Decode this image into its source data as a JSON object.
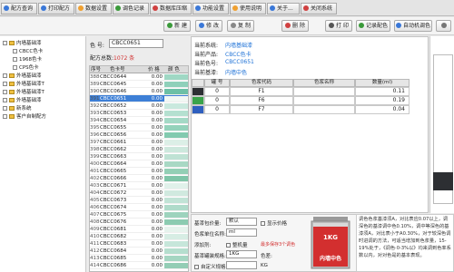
{
  "tabs": [
    {
      "label": "配方查询",
      "color": "#3a78d8"
    },
    {
      "label": "打印配方",
      "color": "#3a78d8"
    },
    {
      "label": "数据设置",
      "color": "#f0a030"
    },
    {
      "label": "调色记录",
      "color": "#3a9a3a"
    },
    {
      "label": "数据库压缩",
      "color": "#d04040"
    },
    {
      "label": "功能设置",
      "color": "#3a78d8"
    },
    {
      "label": "使用说明",
      "color": "#f0a030"
    },
    {
      "label": "关于...",
      "color": "#3a78d8"
    },
    {
      "label": "关闭系统",
      "color": "#d04040"
    }
  ],
  "toolbar": {
    "new": "新 建",
    "edit": "修 改",
    "copy": "复 制",
    "delete": "删 除",
    "print": "打 印",
    "record": "记录配色",
    "auto": "自动机调色"
  },
  "tree": {
    "items": [
      {
        "label": "内墙基础漆",
        "level": 0
      },
      {
        "label": "CBCC色卡",
        "level": 1
      },
      {
        "label": "1968色卡",
        "level": 1
      },
      {
        "label": "CPS色卡",
        "level": 1
      },
      {
        "label": "外墙基础漆",
        "level": 0
      },
      {
        "label": "外墙基础漆T",
        "level": 0
      },
      {
        "label": "外墙基础漆T",
        "level": 0
      },
      {
        "label": "外墙基础漆",
        "level": 0
      },
      {
        "label": "新系统",
        "level": 0
      },
      {
        "label": "客户自制配方",
        "level": 0
      }
    ]
  },
  "list": {
    "color_no_label": "色 号:",
    "color_no_value": "CBCC0651",
    "count_label": "配方总数:",
    "count_value": "1072 条",
    "headers": [
      "序号",
      "色卡号",
      "价 格",
      "颜 色"
    ],
    "rows": [
      {
        "idx": "388",
        "name": "CBCC0644",
        "price": "0.00",
        "color": "#9fd8c4"
      },
      {
        "idx": "389",
        "name": "CBCC0645",
        "price": "0.00",
        "color": "#8fd0ba"
      },
      {
        "idx": "390",
        "name": "CBCC0646",
        "price": "0.00",
        "color": "#6cc0a6"
      },
      {
        "idx": "391",
        "name": "CBCC0651",
        "price": "0.00",
        "color": "#f2f7f4",
        "selected": true
      },
      {
        "idx": "392",
        "name": "CBCC0652",
        "price": "0.00",
        "color": "#c9e9de"
      },
      {
        "idx": "393",
        "name": "CBCC0653",
        "price": "0.00",
        "color": "#b4e0d0"
      },
      {
        "idx": "394",
        "name": "CBCC0654",
        "price": "0.00",
        "color": "#a4d9c6"
      },
      {
        "idx": "395",
        "name": "CBCC0655",
        "price": "0.00",
        "color": "#94d2bb"
      },
      {
        "idx": "396",
        "name": "CBCC0656",
        "price": "0.00",
        "color": "#82caaf"
      },
      {
        "idx": "397",
        "name": "CBCC0661",
        "price": "0.00",
        "color": "#dcefe7"
      },
      {
        "idx": "398",
        "name": "CBCC0662",
        "price": "0.00",
        "color": "#cde8dd"
      },
      {
        "idx": "399",
        "name": "CBCC0663",
        "price": "0.00",
        "color": "#bfe2d4"
      },
      {
        "idx": "400",
        "name": "CBCC0664",
        "price": "0.00",
        "color": "#a8d8c4"
      },
      {
        "idx": "401",
        "name": "CBCC0665",
        "price": "0.00",
        "color": "#93cfb5"
      },
      {
        "idx": "402",
        "name": "CBCC0666",
        "price": "0.00",
        "color": "#7fc5a8"
      },
      {
        "idx": "403",
        "name": "CBCC0671",
        "price": "0.00",
        "color": "#e0f1ea"
      },
      {
        "idx": "404",
        "name": "CBCC0672",
        "price": "0.00",
        "color": "#d0e9df"
      },
      {
        "idx": "405",
        "name": "CBCC0673",
        "price": "0.00",
        "color": "#c1e3d6"
      },
      {
        "idx": "406",
        "name": "CBCC0674",
        "price": "0.00",
        "color": "#afdbca"
      },
      {
        "idx": "407",
        "name": "CBCC0675",
        "price": "0.00",
        "color": "#9dd3bd"
      },
      {
        "idx": "408",
        "name": "CBCC0676",
        "price": "0.00",
        "color": "#8ccbb1"
      },
      {
        "idx": "409",
        "name": "CBCC0681",
        "price": "0.00",
        "color": "#e6f3ed"
      },
      {
        "idx": "410",
        "name": "CBCC0682",
        "price": "0.00",
        "color": "#d7ede4"
      },
      {
        "idx": "411",
        "name": "CBCC0683",
        "price": "0.00",
        "color": "#c6e6da"
      },
      {
        "idx": "412",
        "name": "CBCC0684",
        "price": "0.00",
        "color": "#b5dece"
      },
      {
        "idx": "413",
        "name": "CBCC0685",
        "price": "0.00",
        "color": "#a5d6c2"
      },
      {
        "idx": "414",
        "name": "CBCC0686",
        "price": "0.00",
        "color": "#93cdb5"
      }
    ]
  },
  "formula": {
    "system_label": "当前系统:",
    "system_value": "内墙基础漆",
    "product_label": "当前产品:",
    "product_value": "CBCC色卡",
    "color_label": "当前色号:",
    "color_value": "CBCC0651",
    "base_label": "当前基漆:",
    "base_value": "内墙中色",
    "headers": [
      "罐 号",
      "色浆代码",
      "色浆名称",
      "数量(ml)"
    ],
    "rows": [
      {
        "swatch": "#2d2f33",
        "can": "0",
        "code": "F1",
        "name": "",
        "qty": "0.11"
      },
      {
        "swatch": "#3aa34a",
        "can": "0",
        "code": "F6",
        "name": "",
        "qty": "0.19"
      },
      {
        "swatch": "#2f5fbf",
        "can": "0",
        "code": "F7",
        "name": "",
        "qty": "0.04"
      }
    ]
  },
  "bottom": {
    "currency_label": "基漆包价量:",
    "currency_value": "默认",
    "show_price": "显示价格",
    "unit_label": "色浆单位名称:",
    "unit_value": "ml",
    "sum_label": "添加剂:",
    "sum_check": "整机量",
    "note": "最多保存3个调色",
    "size_label": "基漆罐装规格:",
    "size_value": "1KG",
    "custom_label": "自定义规格:",
    "custom_unit": "KG",
    "diff_label": "色差:",
    "can_size": "1KG",
    "can_name": "内墙中色"
  },
  "description": "调色色浆基漆须A，对比表应0.07以上，调深色的基漆调中色0.10%，调中等深色的基漆须A，对比表小于A0.30%，对于较深色调时进调的方法，可适当增加到色浆量，15-19%处于，《调色·0-3%以》均来调到色率系数以内，对对色是的基本表现。"
}
